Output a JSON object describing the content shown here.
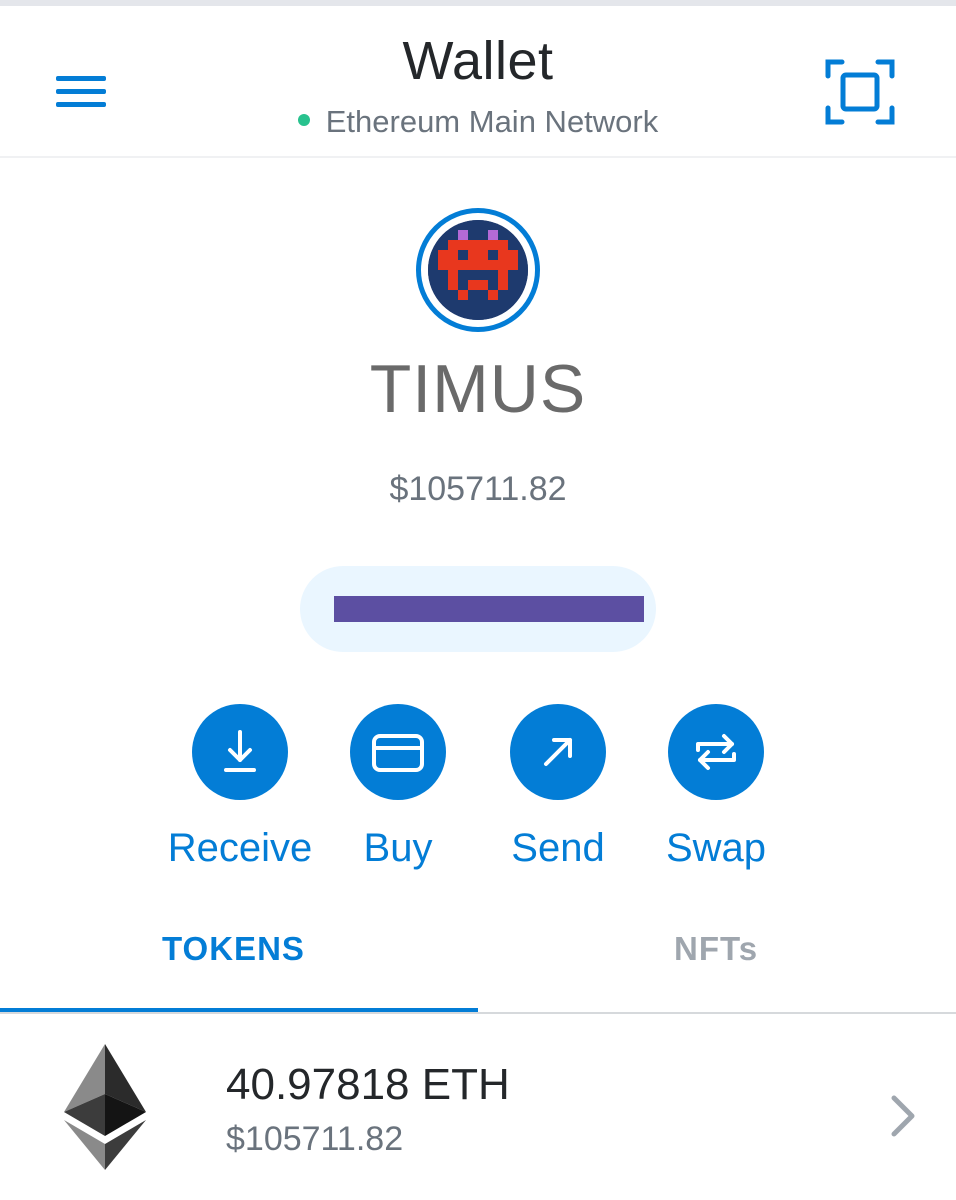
{
  "header": {
    "title": "Wallet",
    "network": "Ethereum Main Network",
    "network_status_color": "#28c28e"
  },
  "account": {
    "name": "TIMUS",
    "balance_fiat": "$105711.82",
    "address_redacted": true
  },
  "actions": [
    {
      "label": "Receive",
      "icon": "download-icon"
    },
    {
      "label": "Buy",
      "icon": "card-icon"
    },
    {
      "label": "Send",
      "icon": "arrow-up-right-icon"
    },
    {
      "label": "Swap",
      "icon": "swap-icon"
    }
  ],
  "tabs": [
    {
      "label": "TOKENS",
      "active": true
    },
    {
      "label": "NFTs",
      "active": false
    }
  ],
  "tokens": [
    {
      "amount": "40.97818 ETH",
      "fiat": "$105711.82",
      "icon": "ethereum-icon"
    }
  ],
  "colors": {
    "accent": "#037dd6",
    "muted_text": "#6a737d",
    "inactive_tab": "#9fa6ae"
  }
}
